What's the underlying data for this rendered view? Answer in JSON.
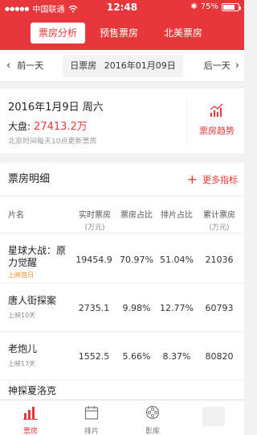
{
  "status": {
    "carrier": "中国联通",
    "time": "12:48",
    "battery": "75%",
    "battery_level": 0.75
  },
  "tabs_top": [
    {
      "label": "票房分析",
      "active": true
    },
    {
      "label": "预售票房",
      "active": false
    },
    {
      "label": "北美票房",
      "active": false
    }
  ],
  "datebar": {
    "prev": "前一天",
    "label": "日票房",
    "date": "2016年01月09日",
    "next": "后一天"
  },
  "summary": {
    "date": "2016年1月9日 周六",
    "dapan_label": "大盘:",
    "dapan_value": "27413.2万",
    "note": "北京时间每天10点更新票房",
    "trend_label": "票房趋势"
  },
  "detail": {
    "title": "票房明细",
    "more": "更多指标"
  },
  "columns": {
    "name": "片名",
    "realtime": "实时票房",
    "realtime_unit": "(万元)",
    "share": "票房占比",
    "seat_share": "排片占比",
    "total": "累计票房",
    "total_unit": "(万元)"
  },
  "rows": [
    {
      "name": "星球大战：原力觉醒",
      "sub": "上映首日",
      "highlight": true,
      "realtime": "19454.9",
      "share": "70.97%",
      "seat_share": "51.04%",
      "total": "21036"
    },
    {
      "name": "唐人街探案",
      "sub": "上映10天",
      "highlight": false,
      "realtime": "2735.1",
      "share": "9.98%",
      "seat_share": "12.77%",
      "total": "60793"
    },
    {
      "name": "老炮儿",
      "sub": "上映17天",
      "highlight": false,
      "realtime": "1552.5",
      "share": "5.66%",
      "seat_share": "8.37%",
      "total": "80820"
    },
    {
      "name": "神探夏洛克",
      "sub": "",
      "highlight": false,
      "realtime": "",
      "share": "",
      "seat_share": "",
      "total": ""
    }
  ],
  "tabbar": [
    {
      "label": "票房",
      "icon": "bar-chart-icon",
      "active": true
    },
    {
      "label": "排片",
      "icon": "calendar-icon",
      "active": false
    },
    {
      "label": "影库",
      "icon": "film-reel-icon",
      "active": false
    },
    {
      "label": "",
      "icon": "blank",
      "active": false
    }
  ],
  "colors": {
    "accent": "#e8373a",
    "highlight": "#f08a2a"
  }
}
